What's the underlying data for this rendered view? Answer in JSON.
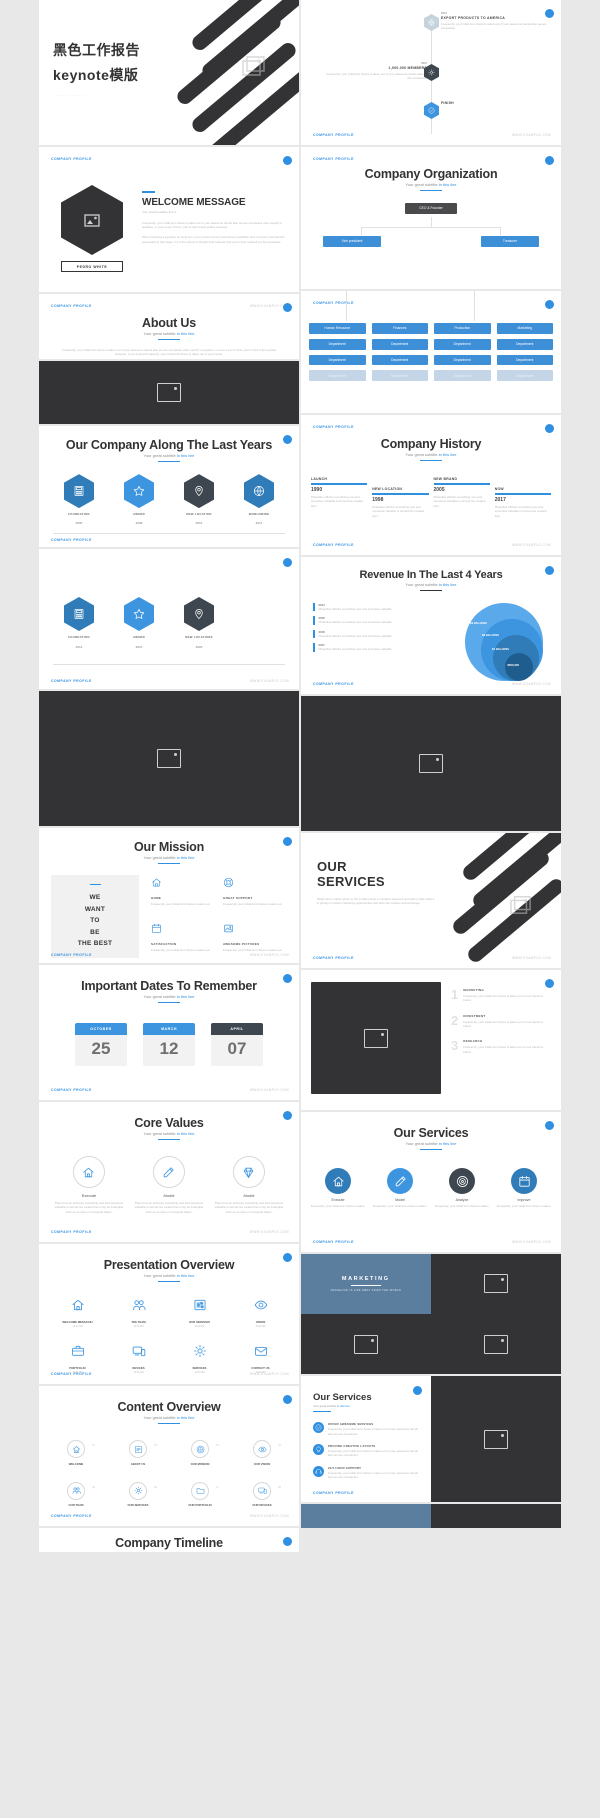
{
  "meta": {
    "company_profile_label": "COMPANY PROFILE",
    "www_label": "WWW.EXAMPLE.COM",
    "subtitle_prefix": "Your great subtitle ",
    "subtitle_link": "in this line",
    "accent": "#2f8fe0",
    "dark": "#333335"
  },
  "cover": {
    "line1": "黑色工作报告",
    "line2": "keynote模版",
    "dots": "..................."
  },
  "welcome": {
    "title": "WELCOME MESSAGE",
    "subtitle": "Your great headline line is",
    "name_tag": "PEDRO WHITE",
    "para1": "Frequently, your initial font choice is taken out of your awesome hands also we are companies often specify a typeface, or even a set of fonts, part of their brand guides However.",
    "para2": "When selecting a typeface for body text, your primary concern should be readability. Don't concern yourself with personality at this stage. I'm of the school of thought that believes that you're best mastering a few typefaces."
  },
  "about": {
    "title": "About Us",
    "body": "Frequently, your initial font choice is taken out of your awesome hands also we are companies often specify a typeface, or even a set of fonts, part of their brand guides However. If you a great Frequently, your initial font choice is taken out of your hands."
  },
  "along_years": {
    "title": "Our Company Along The Last Years",
    "row1": [
      {
        "icon": "calculator-icon",
        "label": "FOUNDATION",
        "year": "2005",
        "color": "#2f7cb8"
      },
      {
        "icon": "star-icon",
        "label": "AWARD",
        "year": "2008",
        "color": "#3d95e0"
      },
      {
        "icon": "pin-icon",
        "label": "NEW LOCATION",
        "year": "2012",
        "color": "#3e4750"
      },
      {
        "icon": "globe-icon",
        "label": "WORLDWIDE",
        "year": "2017",
        "color": "#2f7cb8"
      }
    ],
    "row2": [
      {
        "icon": "calculator-icon",
        "label": "FOUNDATION",
        "year": "2013",
        "color": "#2f7cb8"
      },
      {
        "icon": "star-icon",
        "label": "AWARD",
        "year": "2015",
        "color": "#3d95e0"
      },
      {
        "icon": "pin-icon",
        "label": "NEW LOCATIONS",
        "year": "2020",
        "color": "#3e4750"
      }
    ]
  },
  "timeline_top": {
    "items": [
      {
        "year": "2013",
        "title": "EXPORT PRODUCTS TO AMERICA",
        "body": "Frequently, your initial font choice is taken out of your awesome hands also we are companies."
      },
      {
        "year": "2015",
        "title": "1,000,000 MEMBERS",
        "body": "Frequently, your initial font choice is taken out of your awesome hands also we are companies."
      },
      {
        "year": "",
        "title": "FINISH",
        "body": ""
      }
    ]
  },
  "organization": {
    "title": "Company Organization",
    "root": "CEO & Founder",
    "level2": [
      "Vice president",
      "Treasurer"
    ],
    "level3": [
      "Human Resource",
      "Finances",
      "Production",
      "Marketing"
    ],
    "level4": [
      "Department",
      "Department",
      "Department",
      "Department"
    ],
    "level5": [
      "Department",
      "Department",
      "Department",
      "Department"
    ],
    "level6": [
      "Department",
      "Department",
      "Department",
      "Department"
    ]
  },
  "history": {
    "title": "Company History",
    "entries": [
      {
        "label": "LAUNCH",
        "year": "1990",
        "body": "Phasellus efficitur something new and somehow valuable is formed the created item."
      },
      {
        "label": "NEW LOCATION",
        "year": "1998",
        "body": "Phasellus efficitur something new and somehow valuable is formed the created item."
      },
      {
        "label": "NEW BRAND",
        "year": "2005",
        "body": "Phasellus efficitur something new and somehow valuable is formed the created item."
      },
      {
        "label": "NOW",
        "year": "2017",
        "body": "Phasellus efficitur something new and somehow valuable is formed the created item."
      }
    ]
  },
  "revenue": {
    "title": "Revenue In The Last 4 Years",
    "legend": [
      {
        "year": "2014",
        "body": "Phasellus efficitur something new and somehow valuable."
      },
      {
        "year": "2015",
        "body": "Phasellus efficitur something new and somehow valuable."
      },
      {
        "year": "2016",
        "body": "Phasellus efficitur something new and somehow valuable."
      },
      {
        "year": "2017",
        "body": "Phasellus efficitur something new and somehow valuable."
      }
    ],
    "chart_data": {
      "type": "pie",
      "title": "Revenue In The Last 4 Years",
      "categories": [
        "2014",
        "2015",
        "2016",
        "2017"
      ],
      "labels": [
        "$500,000",
        "$4 BILLIONS",
        "$8 BILLIONS",
        "$9 BILLIONS"
      ],
      "values": [
        0.5,
        4,
        8,
        9
      ],
      "colors": [
        "#1f5d8f",
        "#2f7cb8",
        "#3d95e0",
        "#5aa9ea"
      ],
      "legend": "left"
    }
  },
  "mission": {
    "title": "Our Mission",
    "quote": [
      "WE",
      "WANT",
      "TO",
      "BE",
      "THE BEST"
    ],
    "features": [
      {
        "icon": "home-icon",
        "label": "HOME",
        "body": "Frequently, your initial font choice is taken out."
      },
      {
        "icon": "lifebuoy-icon",
        "label": "GREAT SUPPORT",
        "body": "Frequently, your initial font choice is taken out."
      },
      {
        "icon": "calendar-icon",
        "label": "SATISFACTION",
        "body": "Frequently, your initial font choice is taken out."
      },
      {
        "icon": "picture-icon",
        "label": "AWESOME PICTURES",
        "body": "Frequently, your initial font choice is taken out."
      }
    ]
  },
  "dates": {
    "title": "Important Dates To Remember",
    "items": [
      {
        "month": "OCTOBER",
        "day": "25",
        "color": "#3d95e0"
      },
      {
        "month": "MARCH",
        "day": "12",
        "color": "#3d95e0"
      },
      {
        "month": "APRIL",
        "day": "07",
        "color": "#3e4750"
      }
    ]
  },
  "core_values": {
    "title": "Core Values",
    "items": [
      {
        "icon": "home-icon",
        "label": "Execute",
        "body": "Phenomenon whereby something new and somehow valuable is formed the created item may be intangible such as an idea or a physical object."
      },
      {
        "icon": "pencil-icon",
        "label": "Model",
        "body": "Phenomenon whereby something new and somehow valuable is formed the created item may be intangible such as an idea or a physical object."
      },
      {
        "icon": "diamond-icon",
        "label": "Model",
        "body": "Phenomenon whereby something new and somehow valuable is formed the created item may be intangible such as an idea or a physical object."
      }
    ]
  },
  "presentation_overview": {
    "title": "Presentation Overview",
    "items": [
      {
        "icon": "home-icon",
        "label": "WELCOME MESSAGE!",
        "time": "12:00 AM"
      },
      {
        "icon": "team-icon",
        "label": "THE TEAM",
        "time": "12:00 AM"
      },
      {
        "icon": "sliders-icon",
        "label": "OUR SERVICES",
        "time": "12:00 AM"
      },
      {
        "icon": "eye-icon",
        "label": "VISION",
        "time": "12:00 AM"
      },
      {
        "icon": "briefcase-icon",
        "label": "PORTFOLIO",
        "time": "12:00 AM"
      },
      {
        "icon": "devices-icon",
        "label": "DEVICES",
        "time": "12:00 AM"
      },
      {
        "icon": "gear-icon",
        "label": "SERVICES",
        "time": "12:00 AM"
      },
      {
        "icon": "mail-icon",
        "label": "CONTACT US",
        "time": "12:00 AM"
      }
    ]
  },
  "content_overview": {
    "title": "Content Overview",
    "items": [
      {
        "icon": "home-icon",
        "label": "WELCOME",
        "num": "01"
      },
      {
        "icon": "list-icon",
        "label": "ABOUT US",
        "num": "02"
      },
      {
        "icon": "target-icon",
        "label": "OUR MISSION",
        "num": "03"
      },
      {
        "icon": "eye-icon",
        "label": "OUR VISION",
        "num": "04"
      },
      {
        "icon": "team-icon",
        "label": "OUR TEAM",
        "num": "05"
      },
      {
        "icon": "gear-icon",
        "label": "OUR SERVICES",
        "num": "06"
      },
      {
        "icon": "folder-icon",
        "label": "OUR PORTFOLIO",
        "num": "07"
      },
      {
        "icon": "devices-icon",
        "label": "OUR DEVICES",
        "num": "08"
      }
    ]
  },
  "company_timeline": {
    "title": "Company Timeline"
  },
  "our_services_big": {
    "title_line1": "OUR",
    "title_line2": "SERVICES",
    "body": "Mollis lorem mattis rebum to the condimentum a mentitum deserunt sed tation mollis. Wisi a in gloriup nt mauris marketing opportunities that drive the creative and exchange."
  },
  "services_numbered": {
    "items": [
      {
        "num": "1",
        "label": "MARKETING",
        "body": "Frequently, your initial font choice is taken out of your hands to brand."
      },
      {
        "num": "2",
        "label": "INVESTMENT",
        "body": "Frequently, your initial font choice is taken out of your hands to brand."
      },
      {
        "num": "3",
        "label": "RESEARCH",
        "body": "Frequently, your initial font choice is taken out of your hands to brand."
      }
    ]
  },
  "our_services_icons": {
    "title": "Our Services",
    "items": [
      {
        "icon": "home-icon",
        "label": "Execute",
        "body": "Frequently, your initial font choice is taken.",
        "color": "#2f7cb8"
      },
      {
        "icon": "pencil-icon",
        "label": "Model",
        "body": "Frequently, your initial font choice is taken.",
        "color": "#3d95e0"
      },
      {
        "icon": "target-icon",
        "label": "Analyze",
        "body": "Frequently, your initial font choice is taken.",
        "color": "#3e4750"
      },
      {
        "icon": "calendar-icon",
        "label": "Improve",
        "body": "Frequently, your initial font choice is taken.",
        "color": "#2f7cb8"
      }
    ]
  },
  "marketing_panel": {
    "label": "MARKETING",
    "sub": "TRAVELING IS LIFE AWAY FROM THE WORLD"
  },
  "services_list": {
    "title": "Our Services",
    "items": [
      {
        "icon": "check-icon",
        "label": "OFFER AWESOME SERVICES",
        "body": "Frequently, your initial font choice is taken out of your awesome hands also we are companies."
      },
      {
        "icon": "bulb-icon",
        "label": "PROVIDE CREATIVE LAYOUTS",
        "body": "Frequently, your initial font choice is taken out of your awesome hands also we are companies."
      },
      {
        "icon": "headset-icon",
        "label": "24/7 HOUR SUPPORT",
        "body": "Frequently, your initial font choice is taken out of your awesome hands also we are companies."
      }
    ]
  }
}
